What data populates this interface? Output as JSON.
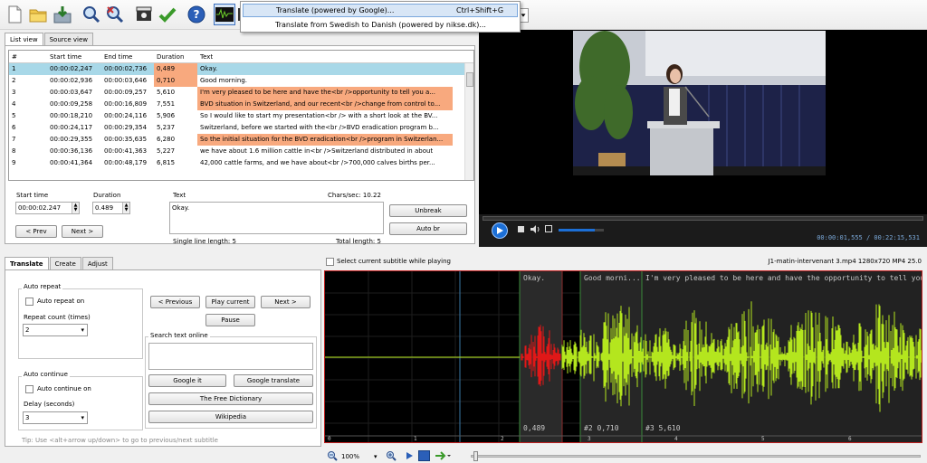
{
  "menu": {
    "items": [
      {
        "label": "Translate (powered by Google)...",
        "shortcut": "Ctrl+Shift+G"
      },
      {
        "label": "Translate from Swedish to Danish (powered by nikse.dk)...",
        "shortcut": ""
      }
    ]
  },
  "tabs": {
    "list_view": "List view",
    "source_view": "Source view"
  },
  "grid": {
    "headers": [
      "#",
      "Start time",
      "End time",
      "Duration",
      "Text"
    ],
    "rows": [
      [
        "1",
        "00:00:02,247",
        "00:00:02,736",
        "0,489",
        "Okay."
      ],
      [
        "2",
        "00:00:02,936",
        "00:00:03,646",
        "0,710",
        "Good morning."
      ],
      [
        "3",
        "00:00:03,647",
        "00:00:09,257",
        "5,610",
        "I'm very pleased to be here and have the<br />opportunity to tell you a..."
      ],
      [
        "4",
        "00:00:09,258",
        "00:00:16,809",
        "7,551",
        "BVD situation in Switzerland, and our recent<br />change from control to..."
      ],
      [
        "5",
        "00:00:18,210",
        "00:00:24,116",
        "5,906",
        "So I would like to start my presentation<br /> with a short look at the BV..."
      ],
      [
        "6",
        "00:00:24,117",
        "00:00:29,354",
        "5,237",
        "Switzerland, before we started with the<br />BVD eradication program b..."
      ],
      [
        "7",
        "00:00:29,355",
        "00:00:35,635",
        "6,280",
        "So the initial situation for the BVD eradication<br />program in Switzerlan..."
      ],
      [
        "8",
        "00:00:36,136",
        "00:00:41,363",
        "5,227",
        "we have about 1.6 million cattle in<br />Switzerland distributed in about"
      ],
      [
        "9",
        "00:00:41,364",
        "00:00:48,179",
        "6,815",
        "42,000 cattle farms, and we have about<br />700,000 calves births per..."
      ]
    ]
  },
  "editor": {
    "start_time_label": "Start time",
    "start_time_value": "00:00:02.247",
    "duration_label": "Duration",
    "duration_value": "0.489",
    "text_label": "Text",
    "chars_sec": "Chars/sec: 10.22",
    "text_value": "Okay.",
    "unbreak": "Unbreak",
    "auto_br": "Auto br",
    "prev": "< Prev",
    "next": "Next >",
    "single_line_length": "Single line length: 5",
    "total_length": "Total length: 5"
  },
  "video": {
    "time_display": "00:00:01,555 / 00:22:15,531",
    "volume_fill": 0.8
  },
  "translate": {
    "tabs": [
      "Translate",
      "Create",
      "Adjust"
    ],
    "auto_repeat_title": "Auto repeat",
    "auto_repeat_on": "Auto repeat on",
    "repeat_count_label": "Repeat count (times)",
    "repeat_count_value": "2",
    "auto_continue_title": "Auto continue",
    "auto_continue_on": "Auto continue on",
    "delay_label": "Delay (seconds)",
    "delay_value": "3",
    "previous": "< Previous",
    "play_current": "Play current",
    "next": "Next >",
    "pause": "Pause",
    "search_online_title": "Search text online",
    "google_it": "Google it",
    "google_translate": "Google translate",
    "free_dictionary": "The Free Dictionary",
    "wikipedia": "Wikipedia",
    "tip": "Tip: Use <alt+arrow up/down> to go to previous/next subtitle"
  },
  "waveform_header": {
    "select_current": "Select current subtitle while playing",
    "file_info": "J1-matin-intervenant 3.mp4 1280x720 MP4 25.0"
  },
  "waveform": {
    "sub1_text": "Okay.",
    "sub2_text": "Good morni...",
    "sub3_text": "I'm very pleased to be here and have the  opportunity to tell you a",
    "sub1_label": "0,489",
    "sub2_label": "#2  0,710",
    "sub3_label": "#3  5,610",
    "ticks": [
      "0",
      "1",
      "2",
      "3",
      "4",
      "5",
      "6"
    ],
    "zoom": "100%"
  },
  "colors": {
    "selected_row": "#a8d8e8",
    "warning": "#f8a97e",
    "wave_green": "#b4e61e",
    "wave_red": "#e01818"
  }
}
